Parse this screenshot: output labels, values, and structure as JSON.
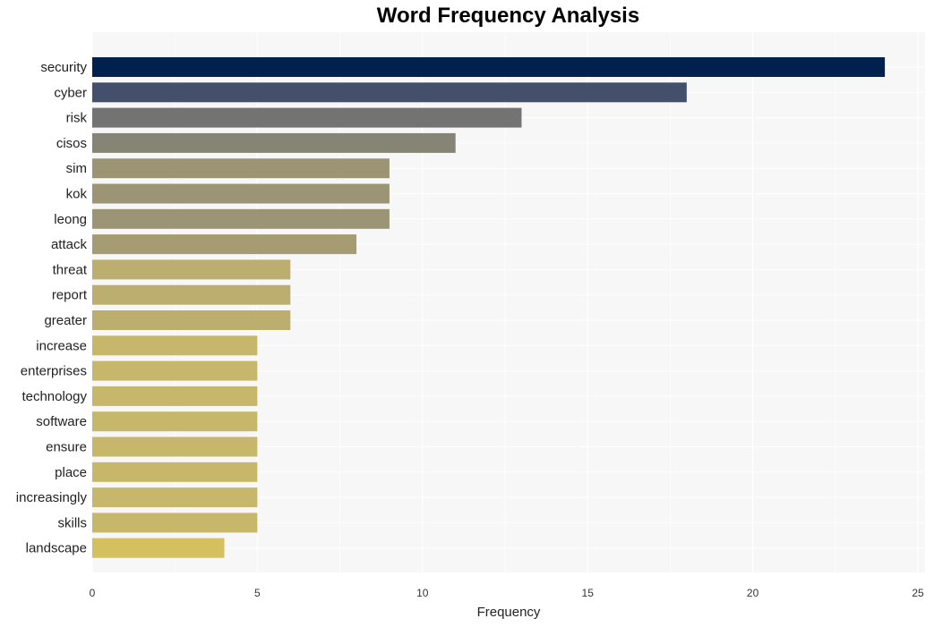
{
  "chart_data": {
    "type": "bar",
    "orientation": "horizontal",
    "title": "Word Frequency Analysis",
    "xlabel": "Frequency",
    "ylabel": "",
    "xlim": [
      0,
      25
    ],
    "xticks": [
      0,
      5,
      10,
      15,
      20,
      25
    ],
    "grid": true,
    "legend": "none",
    "categories": [
      "security",
      "cyber",
      "risk",
      "cisos",
      "sim",
      "kok",
      "leong",
      "attack",
      "threat",
      "report",
      "greater",
      "increase",
      "enterprises",
      "technology",
      "software",
      "ensure",
      "place",
      "increasingly",
      "skills",
      "landscape"
    ],
    "values": [
      24,
      18,
      13,
      11,
      9,
      9,
      9,
      8,
      6,
      6,
      6,
      5,
      5,
      5,
      5,
      5,
      5,
      5,
      5,
      4
    ],
    "colors": [
      "#00204e",
      "#444f6b",
      "#747374",
      "#868474",
      "#9b9475",
      "#9b9475",
      "#9b9475",
      "#a59c73",
      "#bcae6f",
      "#bcae6f",
      "#bcae6f",
      "#c6b76b",
      "#c6b76b",
      "#c6b76b",
      "#c6b76b",
      "#c6b76b",
      "#c6b76b",
      "#c6b76b",
      "#c6b76b",
      "#d4c05f"
    ]
  },
  "style": {
    "plot_background": "#f7f7f7",
    "grid_color": "#ffffff"
  }
}
